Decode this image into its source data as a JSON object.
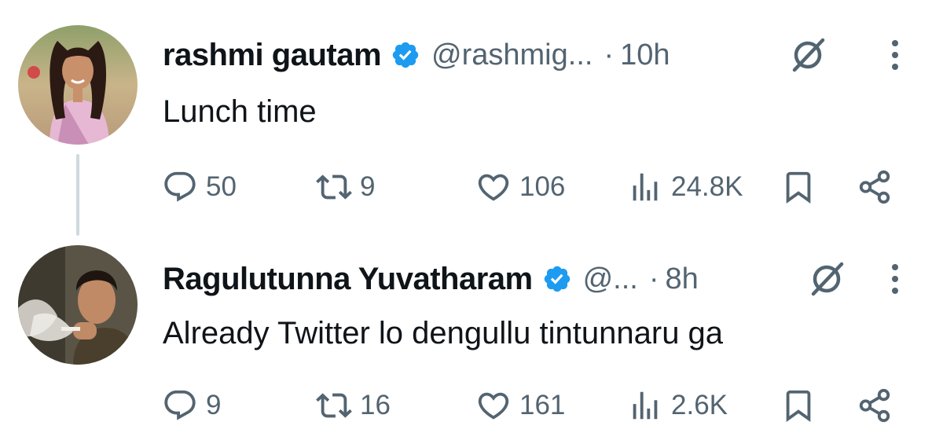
{
  "tweets": [
    {
      "name": "rashmi gautam",
      "handle": "@rashmig...",
      "separator": "·",
      "time": "10h",
      "text": "Lunch time",
      "replies": "50",
      "retweets": "9",
      "likes": "106",
      "views": "24.8K"
    },
    {
      "name": "Ragulutunna Yuvatharam",
      "handle": "@...",
      "separator": "·",
      "time": "8h",
      "text": "Already Twitter lo dengullu tintunnaru ga",
      "replies": "9",
      "retweets": "16",
      "likes": "161",
      "views": "2.6K"
    }
  ],
  "icons": [
    "verified-badge-icon",
    "grok-icon",
    "more-icon",
    "reply-icon",
    "retweet-icon",
    "like-icon",
    "views-icon",
    "bookmark-icon",
    "share-icon"
  ],
  "colors": {
    "verified": "#1d9bf0",
    "secondary_text": "#536471",
    "primary_text": "#0f1419",
    "thread_line": "#cfd9de"
  }
}
